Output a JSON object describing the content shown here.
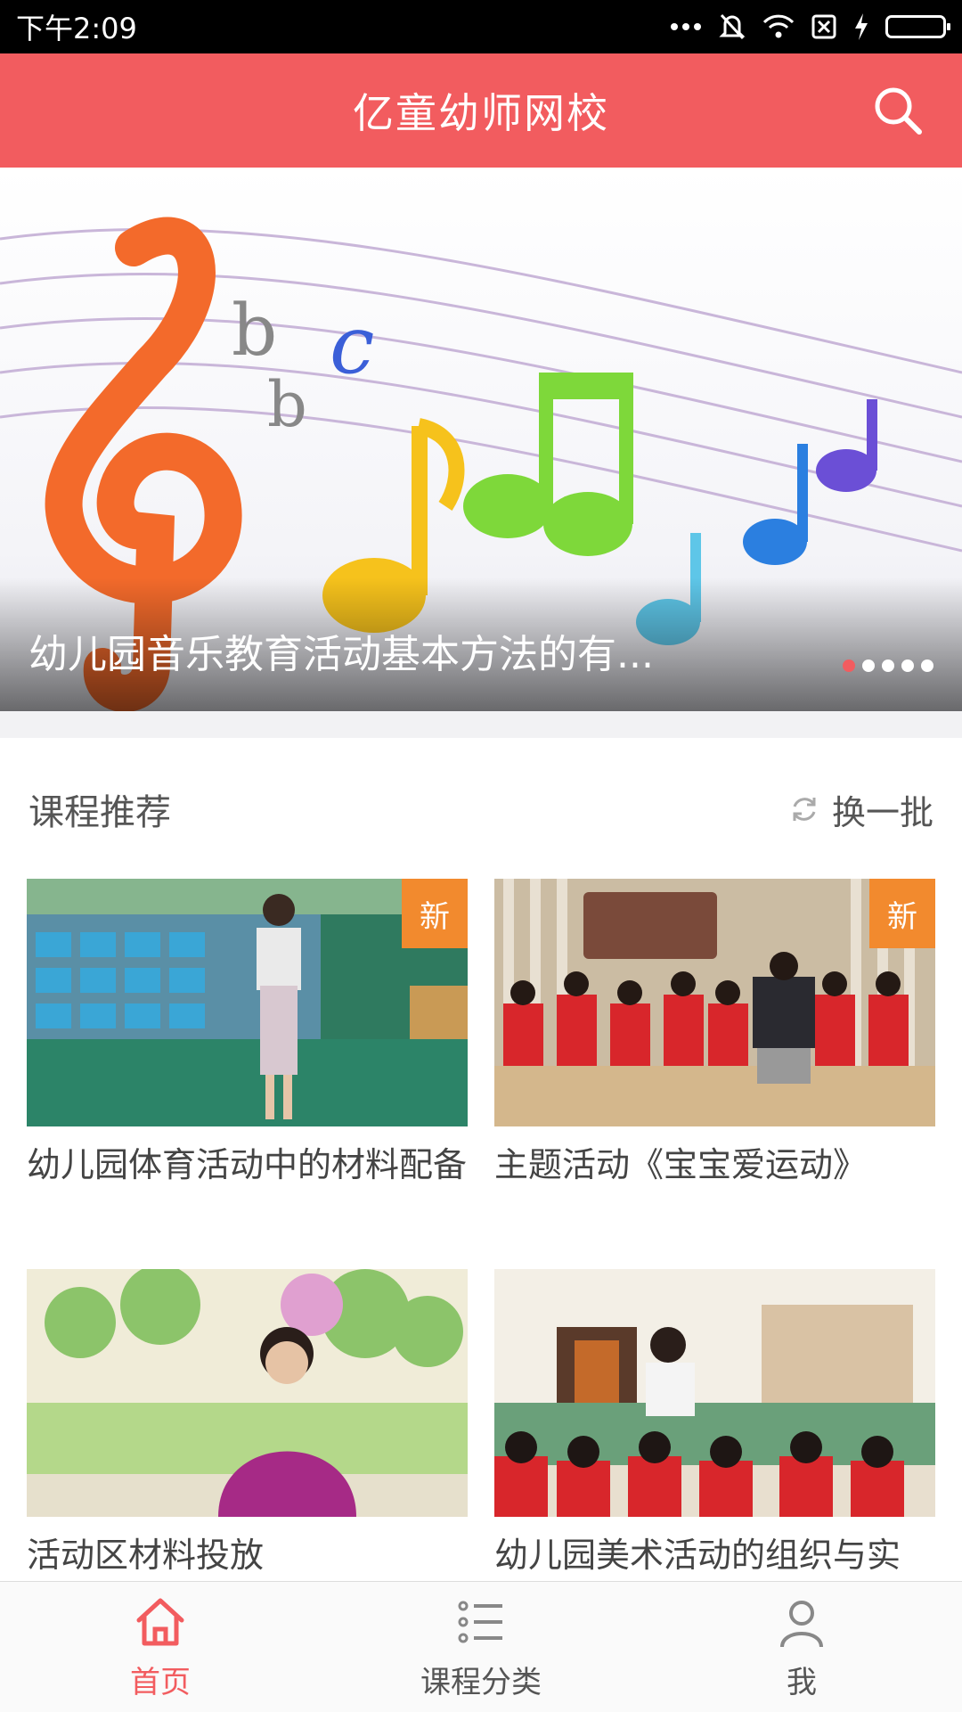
{
  "status_bar": {
    "time": "下午2:09"
  },
  "header": {
    "title": "亿童幼师网校"
  },
  "banner": {
    "caption": "幼儿园音乐教育活动基本方法的有...",
    "dots": 5,
    "active_dot": 0
  },
  "section": {
    "title": "课程推荐",
    "refresh_label": "换一批"
  },
  "courses": [
    {
      "title": "幼儿园体育活动中的材料配备",
      "badge": "新"
    },
    {
      "title": "主题活动《宝宝爱运动》",
      "badge": "新"
    },
    {
      "title": "活动区材料投放",
      "badge": ""
    },
    {
      "title": "幼儿园美术活动的组织与实",
      "badge": ""
    }
  ],
  "bottom_nav": {
    "items": [
      {
        "label": "首页",
        "icon": "home-icon",
        "active": true
      },
      {
        "label": "课程分类",
        "icon": "list-icon",
        "active": false
      },
      {
        "label": "我",
        "icon": "user-icon",
        "active": false
      }
    ]
  },
  "colors": {
    "accent": "#f25c5f",
    "badge": "#f28a2e"
  }
}
